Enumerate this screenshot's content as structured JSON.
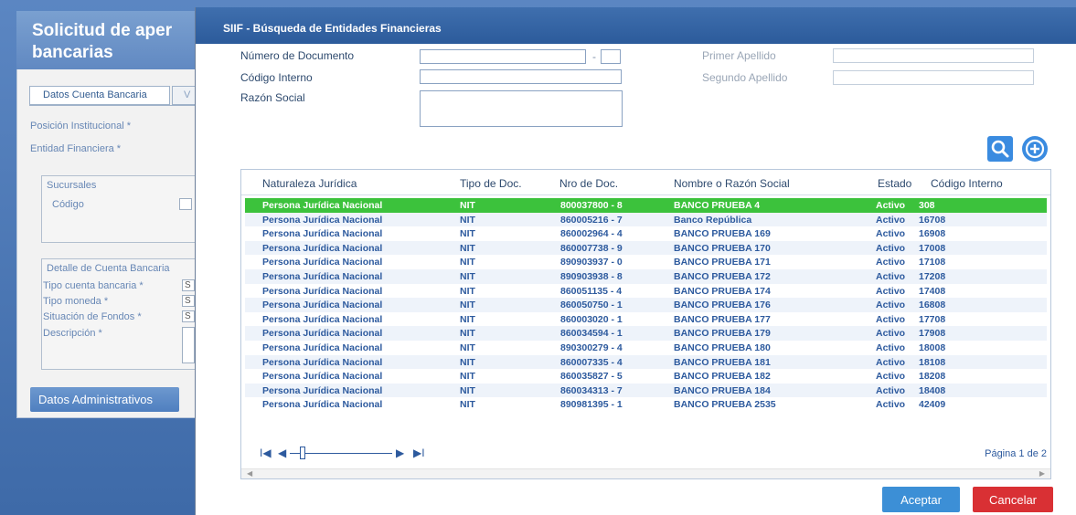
{
  "background": {
    "title_line1": "Solicitud de aper",
    "title_line2": "bancarias",
    "tab_active": "Datos Cuenta Bancaria",
    "tab_other": "V",
    "posicion_label": "Posición Institucional *",
    "entidad_label": "Entidad Financiera *",
    "sucursales_header": "Sucursales",
    "codigo_label": "Código",
    "detalle_header": "Detalle de Cuenta Bancaria",
    "tipo_cuenta_label": "Tipo cuenta bancaria  *",
    "tipo_moneda_label": "Tipo moneda *",
    "situacion_label": "Situación de Fondos *",
    "descripcion_label": "Descripción  *",
    "select_stub": "S",
    "datos_admin_button": "Datos Administrativos"
  },
  "modal": {
    "title": "SIIF - Búsqueda de Entidades Financieras",
    "form": {
      "numero_documento_label": "Número de Documento",
      "dash": "-",
      "codigo_interno_label": "Código Interno",
      "razon_social_label": "Razón Social",
      "primer_apellido_label": "Primer Apellido",
      "segundo_apellido_label": "Segundo Apellido"
    },
    "icons": {
      "search": "search-icon",
      "add": "add-circle-icon"
    },
    "table": {
      "columns": [
        "Naturaleza Jurídica",
        "Tipo de Doc.",
        "Nro de Doc.",
        "Nombre o Razón Social",
        "Estado",
        "Código Interno"
      ],
      "rows": [
        [
          "Persona Jurídica Nacional",
          "NIT",
          "800037800 - 8",
          "BANCO PRUEBA 4",
          "Activo",
          "308"
        ],
        [
          "Persona Jurídica Nacional",
          "NIT",
          "860005216 - 7",
          "Banco República",
          "Activo",
          "16708"
        ],
        [
          "Persona Jurídica Nacional",
          "NIT",
          "860002964 - 4",
          "BANCO PRUEBA 169",
          "Activo",
          "16908"
        ],
        [
          "Persona Jurídica Nacional",
          "NIT",
          "860007738 - 9",
          "BANCO PRUEBA 170",
          "Activo",
          "17008"
        ],
        [
          "Persona Jurídica Nacional",
          "NIT",
          "890903937 - 0",
          "BANCO PRUEBA 171",
          "Activo",
          "17108"
        ],
        [
          "Persona Jurídica Nacional",
          "NIT",
          "890903938 - 8",
          "BANCO PRUEBA 172",
          "Activo",
          "17208"
        ],
        [
          "Persona Jurídica Nacional",
          "NIT",
          "860051135 - 4",
          "BANCO PRUEBA 174",
          "Activo",
          "17408"
        ],
        [
          "Persona Jurídica Nacional",
          "NIT",
          "860050750 - 1",
          "BANCO PRUEBA 176",
          "Activo",
          "16808"
        ],
        [
          "Persona Jurídica Nacional",
          "NIT",
          "860003020 - 1",
          "BANCO PRUEBA 177",
          "Activo",
          "17708"
        ],
        [
          "Persona Jurídica Nacional",
          "NIT",
          "860034594 - 1",
          "BANCO PRUEBA 179",
          "Activo",
          "17908"
        ],
        [
          "Persona Jurídica Nacional",
          "NIT",
          "890300279 - 4",
          "BANCO PRUEBA 180",
          "Activo",
          "18008"
        ],
        [
          "Persona Jurídica Nacional",
          "NIT",
          "860007335 - 4",
          "BANCO PRUEBA 181",
          "Activo",
          "18108"
        ],
        [
          "Persona Jurídica Nacional",
          "NIT",
          "860035827 - 5",
          "BANCO PRUEBA 182",
          "Activo",
          "18208"
        ],
        [
          "Persona Jurídica Nacional",
          "NIT",
          "860034313 - 7",
          "BANCO PRUEBA 184",
          "Activo",
          "18408"
        ],
        [
          "Persona Jurídica Nacional",
          "NIT",
          "890981395 - 1",
          "BANCO PRUEBA 2535",
          "Activo",
          "42409"
        ]
      ],
      "selected_row": 0
    },
    "pager": {
      "first": "I◀",
      "prev": "◀",
      "next": "▶",
      "last": "▶I",
      "page_text": "Página 1 de 2"
    },
    "accept_button": "Aceptar",
    "cancel_button": "Cancelar"
  },
  "colors": {
    "header_blue": "#2c5b9b",
    "selected_row": "#3cc23c",
    "accept": "#3c8fd6",
    "cancel": "#d93034"
  }
}
